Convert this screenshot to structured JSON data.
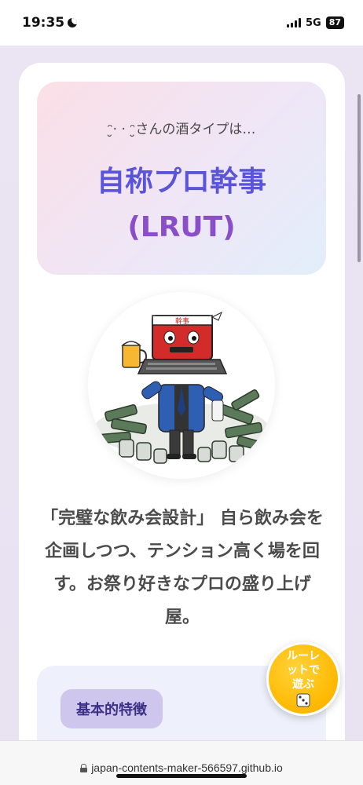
{
  "status_bar": {
    "time": "19:35",
    "network": "5G",
    "battery": "87"
  },
  "hero": {
    "subtitle": "ᵔ̮· · ᵔ̮さんの酒タイプは…",
    "title": "自称プロ幹事",
    "code": "(LRUT)"
  },
  "character": {
    "headband_text": "幹事",
    "image_label": "laptop-head organizer character with beer and sake bottles"
  },
  "description": "「完璧な飲み会設計」 自ら飲み会を企画しつつ、テンション高く場を回す。お祭り好きなプロの盛り上げ屋。",
  "features": {
    "tag": "基本的特徴"
  },
  "roulette": {
    "label_line1": "ルーレ",
    "label_line2": "ットで",
    "label_line3": "遊ぶ",
    "icon": "dice-icon"
  },
  "browser": {
    "url": "japan-contents-maker-566597.github.io"
  },
  "colors": {
    "title": "#5a55d8",
    "code": "#8a4fc8",
    "roulette": "#ffb800",
    "tag_bg": "#cfc6ee"
  }
}
